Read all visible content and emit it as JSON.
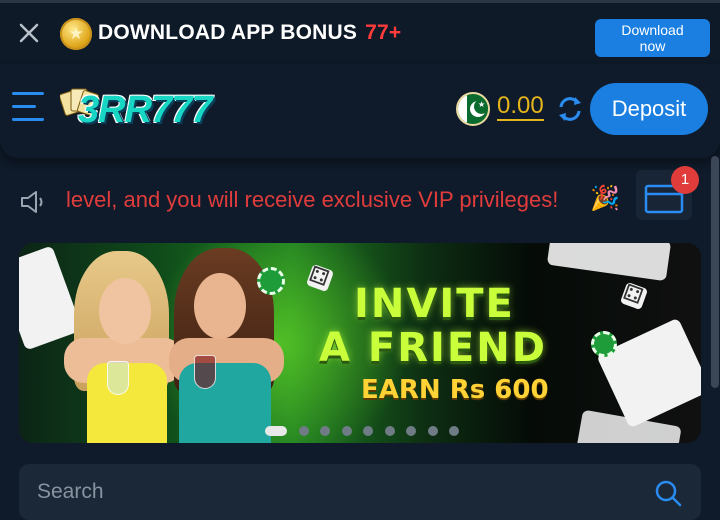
{
  "promo": {
    "title": "DOWNLOAD APP  BONUS",
    "bonus": "77+",
    "download_label": "Download now"
  },
  "header": {
    "logo_text": "3RR777",
    "balance": "0.00",
    "deposit_label": "Deposit"
  },
  "marquee": {
    "text": "level, and you will receive exclusive VIP privileges!",
    "mail_badge": "1"
  },
  "banner": {
    "line1": "INVITE",
    "line2": "A FRIEND",
    "line3": "EARN Rs 600",
    "slide_count": 9,
    "active_slide": 1
  },
  "search": {
    "placeholder": "Search"
  },
  "colors": {
    "background": "#0f1b2a",
    "accent_blue": "#1a7fe0",
    "balance_gold": "#e5b51c",
    "marquee_red": "#e03c3c"
  }
}
